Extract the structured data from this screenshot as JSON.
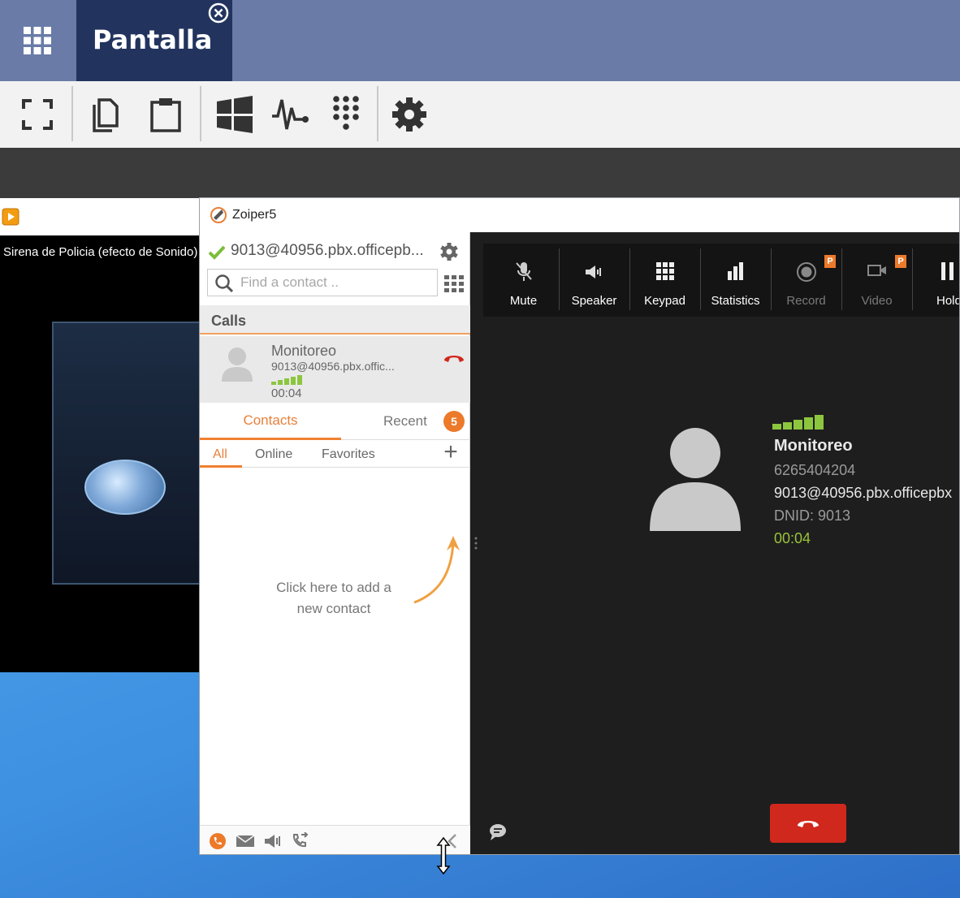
{
  "tabbar": {
    "tab_title": "Pantalla"
  },
  "video": {
    "title": "Sirena de Policia (efecto de Sonido)"
  },
  "zoiper": {
    "window_title": "Zoiper5",
    "account": "9013@40956.pbx.officepb...",
    "search_placeholder": "Find a contact ..",
    "calls_header": "Calls",
    "call": {
      "name": "Monitoreo",
      "uri": "9013@40956.pbx.offic...",
      "time": "00:04"
    },
    "tabs": {
      "contacts": "Contacts",
      "recent": "Recent",
      "recent_count": "5"
    },
    "filters": {
      "all": "All",
      "online": "Online",
      "favorites": "Favorites"
    },
    "hint_line1": "Click here to add a",
    "hint_line2": "new contact",
    "controls": {
      "mute": "Mute",
      "speaker": "Speaker",
      "keypad": "Keypad",
      "statistics": "Statistics",
      "record": "Record",
      "video": "Video",
      "hold": "Hold",
      "premium_badge": "P"
    },
    "active_call": {
      "name": "Monitoreo",
      "number": "6265404204",
      "uri": "9013@40956.pbx.officepbx",
      "dnid": "DNID: 9013",
      "time": "00:04"
    }
  },
  "colors": {
    "tabbar": "#6a7ba8",
    "active_tab": "#22345e",
    "accent_orange": "#ec7a2a",
    "signal_green": "#8cc63f",
    "hangup_red": "#d0281c"
  }
}
